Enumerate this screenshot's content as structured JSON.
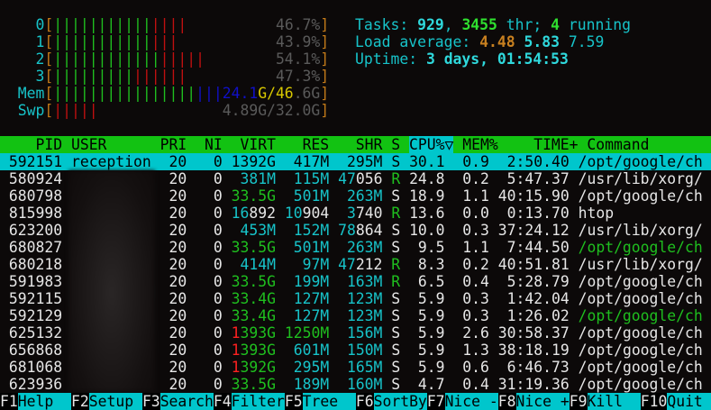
{
  "meters": {
    "cpus": [
      {
        "label": "0",
        "green": 11,
        "red": 4,
        "value": "46.7%"
      },
      {
        "label": "1",
        "green": 11,
        "red": 3,
        "value": "43.9%"
      },
      {
        "label": "2",
        "green": 12,
        "red": 5,
        "value": "54.1%"
      },
      {
        "label": "3",
        "green": 9,
        "red": 6,
        "value": "47.3%"
      }
    ],
    "mem": {
      "label": "Mem",
      "green": 16,
      "blue": 3,
      "used": "24.1",
      "used_unit": "G/46",
      "rest": ".6G"
    },
    "swp": {
      "label": "Swp",
      "red": 5,
      "value": "4.89G/32.0G"
    }
  },
  "summary": {
    "tasks_label": "Tasks: ",
    "tasks": "929",
    "sep1": ", ",
    "threads": "3455",
    "thr_label": " thr; ",
    "running": "4",
    "running_label": " running",
    "load_label": "Load average: ",
    "load1": "4.48",
    "load5": "5.83",
    "load15": "7.59",
    "uptime_label": "Uptime: ",
    "uptime": "3 days, 01:54:53"
  },
  "table": {
    "headers": [
      "PID",
      "USER",
      "PRI",
      "NI",
      "VIRT",
      "RES",
      "SHR",
      "S",
      "CPU%▽",
      "MEM%",
      "TIME+",
      "Command"
    ],
    "sort_column": "CPU%",
    "rows": [
      {
        "pid": "592151",
        "user": "reception",
        "pri": "20",
        "ni": "0",
        "virt": "1392G",
        "res": "417M",
        "shr": "295M",
        "s": "S",
        "cpu": "30.1",
        "mem": "0.9",
        "time": "2:50.40",
        "cmd": "/opt/google/ch",
        "selected": true
      },
      {
        "pid": "580924",
        "user": "",
        "pri": "20",
        "ni": "0",
        "virt": "381M",
        "res": "115M",
        "shr": "47056",
        "s": "R",
        "cpu": "24.8",
        "mem": "0.2",
        "time": "5:47.37",
        "cmd": "/usr/lib/xorg/"
      },
      {
        "pid": "680798",
        "user": "",
        "pri": "20",
        "ni": "0",
        "virt": "33.5G",
        "res": "501M",
        "shr": "263M",
        "s": "S",
        "cpu": "18.9",
        "mem": "1.1",
        "time": "40:15.90",
        "cmd": "/opt/google/ch"
      },
      {
        "pid": "815998",
        "user": "",
        "pri": "20",
        "ni": "0",
        "virt": "16892",
        "res": "10904",
        "shr": "3740",
        "s": "R",
        "cpu": "13.6",
        "mem": "0.0",
        "time": "0:13.70",
        "cmd": "htop"
      },
      {
        "pid": "623200",
        "user": "",
        "pri": "20",
        "ni": "0",
        "virt": "453M",
        "res": "152M",
        "shr": "78864",
        "s": "S",
        "cpu": "10.0",
        "mem": "0.3",
        "time": "37:24.12",
        "cmd": "/usr/lib/xorg/"
      },
      {
        "pid": "680827",
        "user": "",
        "pri": "20",
        "ni": "0",
        "virt": "33.5G",
        "res": "501M",
        "shr": "263M",
        "s": "S",
        "cpu": "9.5",
        "mem": "1.1",
        "time": "7:44.50",
        "cmd": "/opt/google/ch",
        "thread": true
      },
      {
        "pid": "680218",
        "user": "",
        "pri": "20",
        "ni": "0",
        "virt": "414M",
        "res": "97M",
        "shr": "47212",
        "s": "R",
        "cpu": "8.3",
        "mem": "0.2",
        "time": "40:51.81",
        "cmd": "/usr/lib/xorg/"
      },
      {
        "pid": "591983",
        "user": "",
        "pri": "20",
        "ni": "0",
        "virt": "33.5G",
        "res": "199M",
        "shr": "163M",
        "s": "R",
        "cpu": "6.5",
        "mem": "0.4",
        "time": "5:28.79",
        "cmd": "/opt/google/ch"
      },
      {
        "pid": "592115",
        "user": "",
        "pri": "20",
        "ni": "0",
        "virt": "33.4G",
        "res": "127M",
        "shr": "123M",
        "s": "S",
        "cpu": "5.9",
        "mem": "0.3",
        "time": "1:42.04",
        "cmd": "/opt/google/ch"
      },
      {
        "pid": "592129",
        "user": "",
        "pri": "20",
        "ni": "0",
        "virt": "33.4G",
        "res": "127M",
        "shr": "123M",
        "s": "S",
        "cpu": "5.9",
        "mem": "0.3",
        "time": "1:26.02",
        "cmd": "/opt/google/ch",
        "thread": true
      },
      {
        "pid": "625132",
        "user": "",
        "pri": "20",
        "ni": "0",
        "virt": "1393G",
        "res": "1250M",
        "shr": "156M",
        "s": "S",
        "cpu": "5.9",
        "mem": "2.6",
        "time": "30:58.37",
        "cmd": "/opt/google/ch"
      },
      {
        "pid": "656868",
        "user": "",
        "pri": "20",
        "ni": "0",
        "virt": "1393G",
        "res": "601M",
        "shr": "150M",
        "s": "S",
        "cpu": "5.9",
        "mem": "1.3",
        "time": "38:18.19",
        "cmd": "/opt/google/ch"
      },
      {
        "pid": "681068",
        "user": "",
        "pri": "20",
        "ni": "0",
        "virt": "1392G",
        "res": "295M",
        "shr": "165M",
        "s": "S",
        "cpu": "5.9",
        "mem": "0.6",
        "time": "6:46.73",
        "cmd": "/opt/google/ch"
      },
      {
        "pid": "623936",
        "user": "",
        "pri": "20",
        "ni": "0",
        "virt": "33.5G",
        "res": "189M",
        "shr": "160M",
        "s": "S",
        "cpu": "4.7",
        "mem": "0.4",
        "time": "31:19.36",
        "cmd": "/opt/google/ch"
      }
    ]
  },
  "footer": [
    {
      "key": "F1",
      "label": "Help"
    },
    {
      "key": "F2",
      "label": "Setup"
    },
    {
      "key": "F3",
      "label": "Search"
    },
    {
      "key": "F4",
      "label": "Filter"
    },
    {
      "key": "F5",
      "label": "Tree"
    },
    {
      "key": "F6",
      "label": "SortBy"
    },
    {
      "key": "F7",
      "label": "Nice -"
    },
    {
      "key": "F8",
      "label": "Nice +"
    },
    {
      "key": "F9",
      "label": "Kill"
    },
    {
      "key": "F10",
      "label": "Quit"
    }
  ],
  "colors": {
    "header_bg": "#12c212",
    "selection_bg": "#00c6cc",
    "cyan": "#17c3c9",
    "green": "#1fbf1f",
    "red": "#c01010",
    "background": "#0c0909"
  }
}
